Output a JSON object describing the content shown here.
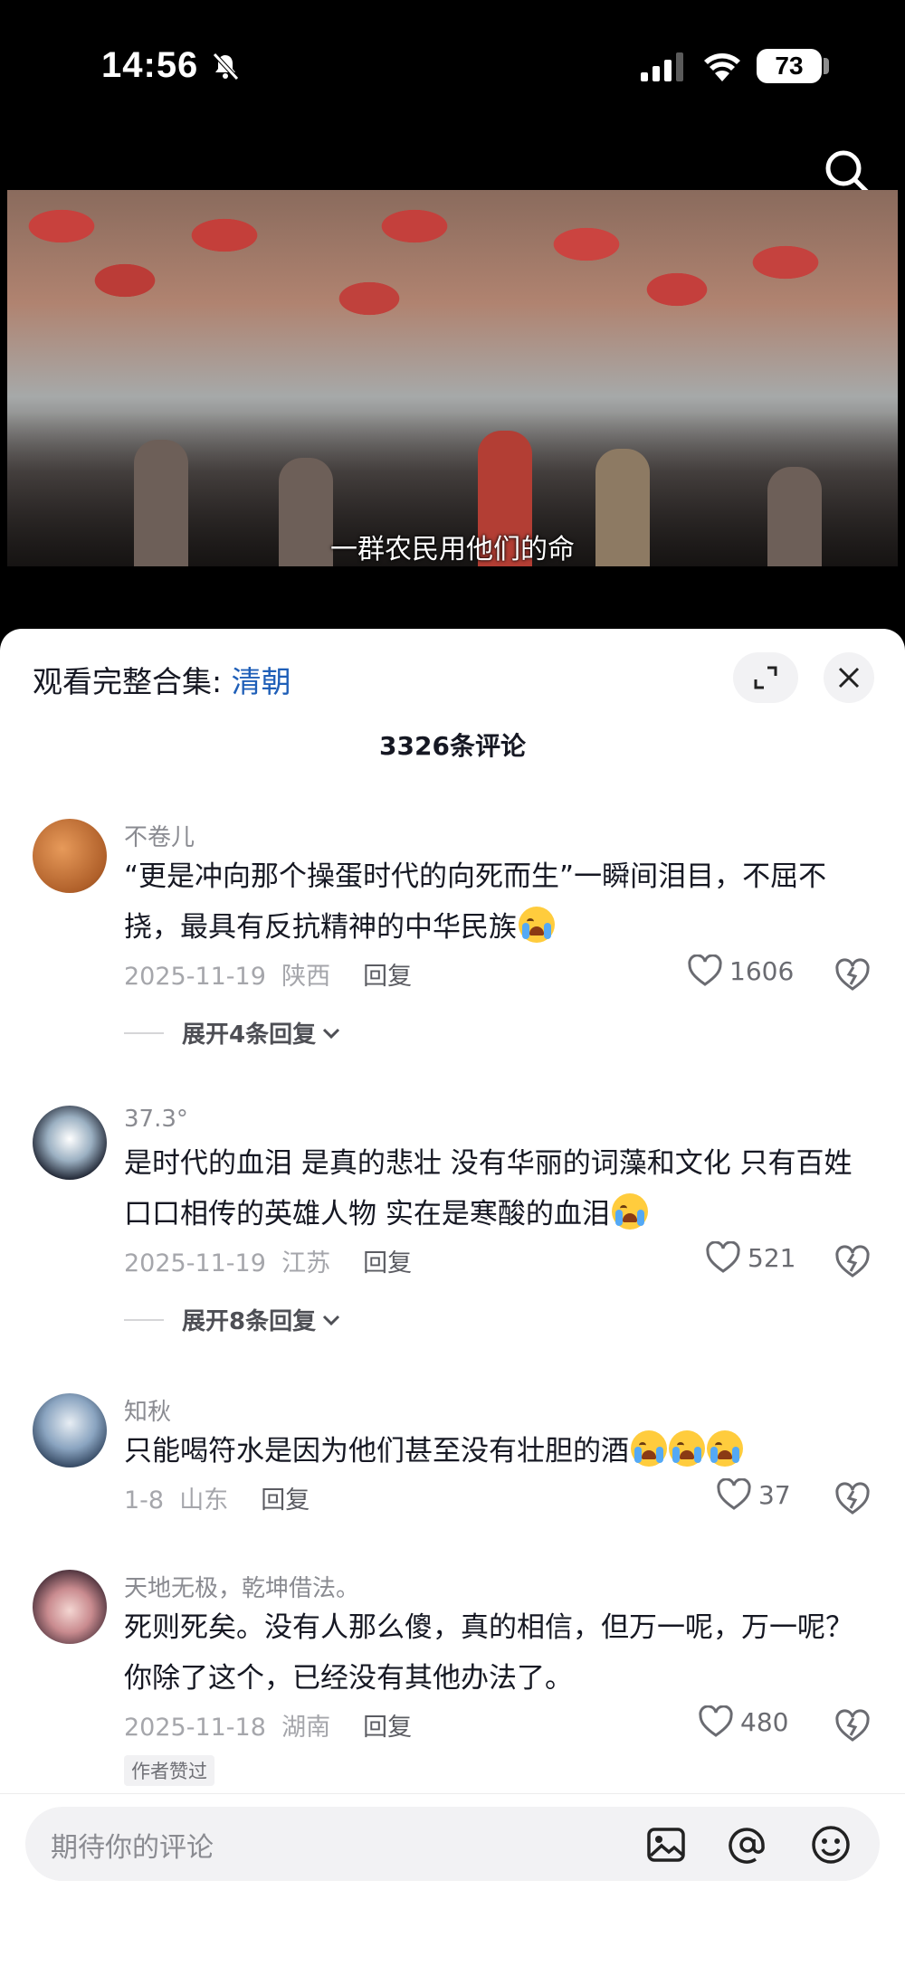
{
  "status_bar": {
    "time": "14:56",
    "battery": "73"
  },
  "video": {
    "subtitle": "一群农民用他们的命"
  },
  "sheet": {
    "collection_prefix": "观看完整合集: ",
    "collection_name": "清朝",
    "comment_count": "3326条评论"
  },
  "comments": [
    {
      "username": "不卷儿",
      "text": "“更是冲向那个操蛋时代的向死而生”一瞬间泪目，不屈不挠，最具有反抗精神的中华民族",
      "emoji_count": 1,
      "date": "2025-11-19",
      "location": "陕西",
      "reply": "回复",
      "likes": "1606",
      "expand": "展开4条回复"
    },
    {
      "username": "37.3°",
      "text": "是时代的血泪 是真的悲壮 没有华丽的词藻和文化 只有百姓口口相传的英雄人物 实在是寒酸的血泪",
      "emoji_count": 1,
      "date": "2025-11-19",
      "location": "江苏",
      "reply": "回复",
      "likes": "521",
      "expand": "展开8条回复"
    },
    {
      "username": "知秋",
      "text": "只能喝符水是因为他们甚至没有壮胆的酒",
      "emoji_count": 3,
      "date": "1-8",
      "location": "山东",
      "reply": "回复",
      "likes": "37"
    },
    {
      "username": "天地无极，乾坤借法。",
      "text": "死则死矣。没有人那么傻，真的相信，但万一呢，万一呢？你除了这个，已经没有其他办法了。",
      "date": "2025-11-18",
      "location": "湖南",
      "reply": "回复",
      "likes": "480",
      "badge": "作者赞过"
    }
  ],
  "input": {
    "placeholder": "期待你的评论"
  },
  "icons": [
    "mute-icon",
    "signal-icon",
    "wifi-icon",
    "search-icon",
    "expand-icon",
    "close-icon",
    "heart-icon",
    "dislike-icon",
    "chevron-down-icon",
    "image-icon",
    "at-icon",
    "emoji-icon"
  ]
}
